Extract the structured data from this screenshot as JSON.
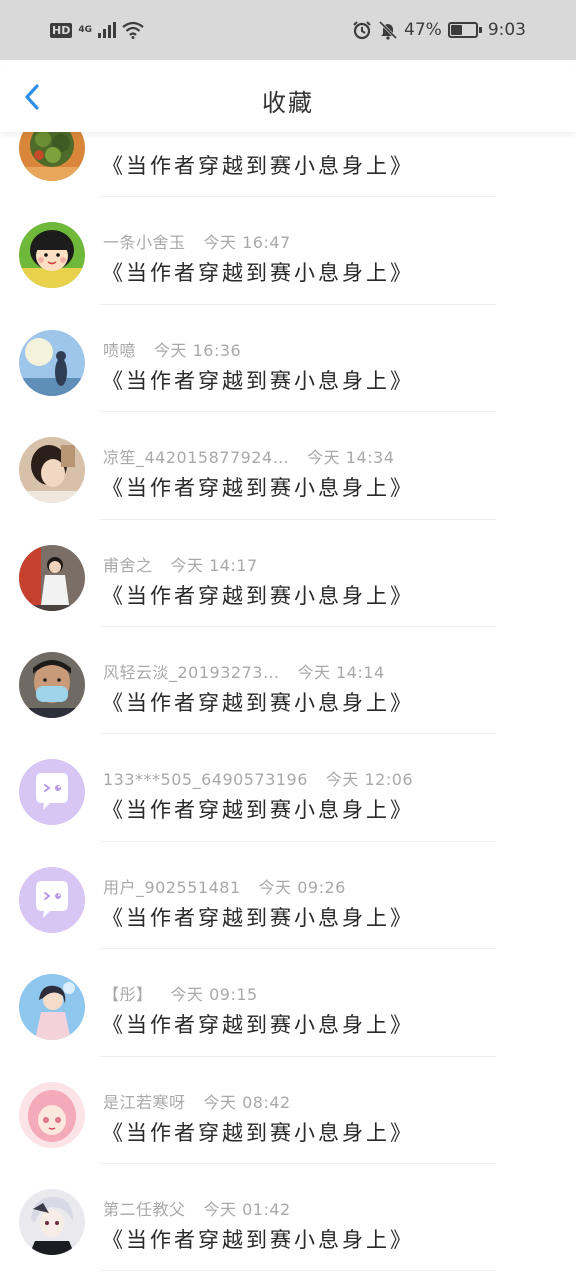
{
  "status_bar": {
    "hd": "HD",
    "network": "4G",
    "battery_percent": "47%",
    "battery_level": 0.47,
    "time": "9:03",
    "icons": [
      "hd-icon",
      "signal-icon",
      "wifi-icon",
      "alarm-icon",
      "mute-icon",
      "battery-icon"
    ]
  },
  "header": {
    "title": "收藏",
    "back_icon": "chevron-left-icon",
    "accent": "#2f8fe6"
  },
  "items": [
    {
      "user": "",
      "time": "",
      "book": "《当作者穿越到赛小息身上》",
      "avatar": "food"
    },
    {
      "user": "一条小舍玉",
      "time": "今天 16:47",
      "book": "《当作者穿越到赛小息身上》",
      "avatar": "cartoon-girl"
    },
    {
      "user": "啧噫",
      "time": "今天 16:36",
      "book": "《当作者穿越到赛小息身上》",
      "avatar": "sky-figure"
    },
    {
      "user": "凉笙_442015877924…",
      "time": "今天 14:34",
      "book": "《当作者穿越到赛小息身上》",
      "avatar": "girl-hair"
    },
    {
      "user": "甫舍之",
      "time": "今天 14:17",
      "book": "《当作者穿越到赛小息身上》",
      "avatar": "girl-dress"
    },
    {
      "user": "风轻云淡_20193273…",
      "time": "今天 14:14",
      "book": "《当作者穿越到赛小息身上》",
      "avatar": "man-mask"
    },
    {
      "user": "133***505_6490573196",
      "time": "今天 12:06",
      "book": "《当作者穿越到赛小息身上》",
      "avatar": "default"
    },
    {
      "user": "用户_902551481",
      "time": "今天 09:26",
      "book": "《当作者穿越到赛小息身上》",
      "avatar": "default"
    },
    {
      "user": "【彤】",
      "time": "今天 09:15",
      "book": "《当作者穿越到赛小息身上》",
      "avatar": "anime-blue"
    },
    {
      "user": "是江若寒呀",
      "time": "今天 08:42",
      "book": "《当作者穿越到赛小息身上》",
      "avatar": "anime-pink"
    },
    {
      "user": "第二任教父",
      "time": "今天 01:42",
      "book": "《当作者穿越到赛小息身上》",
      "avatar": "anime-dark"
    }
  ]
}
